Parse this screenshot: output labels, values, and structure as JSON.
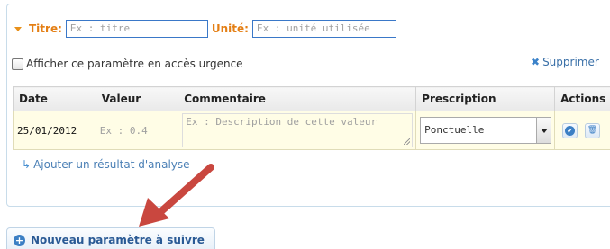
{
  "header": {
    "title_label": "Titre:",
    "title_placeholder": "Ex : titre",
    "unit_label": "Unité:",
    "unit_placeholder": "Ex : unité utilisée"
  },
  "urgency": {
    "label": "Afficher ce paramètre en accès urgence",
    "checked": false
  },
  "delete_label": "Supprimer",
  "table": {
    "columns": [
      "Date",
      "Valeur",
      "Commentaire",
      "Prescription",
      "Actions"
    ],
    "row": {
      "date": "25/01/2012",
      "value_placeholder": "Ex : 0.4",
      "comment_placeholder": "Ex : Description de cette valeur",
      "prescription": "Ponctuelle"
    }
  },
  "add_result_label": "Ajouter un résultat d'analyse",
  "new_param_label": "Nouveau paramètre à suivre",
  "colors": {
    "accent": "#e47f15",
    "link": "#3b7fc4",
    "arrow": "#c9473f"
  }
}
